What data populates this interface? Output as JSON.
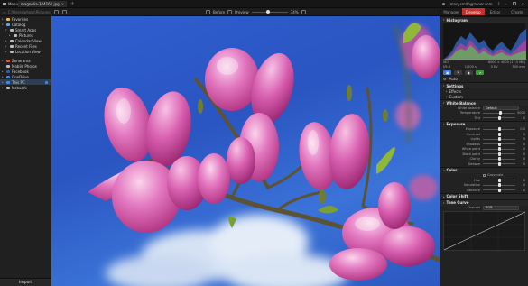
{
  "titlebar": {
    "menu_label": "Menu",
    "tab_title": "magnolia-324161.jpg",
    "user": "mary.smith@zoner.com"
  },
  "left": {
    "path": "C:\\Users\\photo\\Pictures",
    "items": [
      {
        "label": "Favorites",
        "icon": "star-icon",
        "color": "#e8c23a",
        "indent": 0,
        "twisty": "▸"
      },
      {
        "label": "Catalog",
        "icon": "catalog-icon",
        "color": "#6aa0e0",
        "indent": 0,
        "twisty": "▾"
      },
      {
        "label": "Smart Apps",
        "icon": "folder-icon",
        "color": "#bbbbbb",
        "indent": 1,
        "twisty": "▾"
      },
      {
        "label": "Pictures",
        "icon": "folder-icon",
        "color": "#bbbbbb",
        "indent": 2,
        "twisty": "▸"
      },
      {
        "label": "Calendar View",
        "icon": "calendar-icon",
        "color": "#bbbbbb",
        "indent": 1,
        "twisty": "▸"
      },
      {
        "label": "Recent Files",
        "icon": "clock-icon",
        "color": "#bbbbbb",
        "indent": 1,
        "twisty": "▸"
      },
      {
        "label": "Location View",
        "icon": "pin-icon",
        "color": "#bbbbbb",
        "indent": 1,
        "twisty": "▸"
      },
      {
        "label": "Zonerama",
        "icon": "cloud-icon",
        "color": "#e05a2a",
        "indent": 0,
        "twisty": "▸",
        "gap": true
      },
      {
        "label": "Mobile Photos",
        "icon": "phone-icon",
        "color": "#bbbbbb",
        "indent": 0,
        "twisty": ""
      },
      {
        "label": "Facebook",
        "icon": "facebook-icon",
        "color": "#3b5998",
        "indent": 0,
        "twisty": "▸"
      },
      {
        "label": "OneDrive",
        "icon": "onedrive-icon",
        "color": "#3a8dde",
        "indent": 0,
        "twisty": "▸"
      },
      {
        "label": "This PC",
        "icon": "computer-icon",
        "color": "#3a8dde",
        "indent": 0,
        "twisty": "▸",
        "active": true
      },
      {
        "label": "Network",
        "icon": "network-icon",
        "color": "#bbbbbb",
        "indent": 0,
        "twisty": "▸"
      }
    ],
    "import_label": "Import"
  },
  "toolbar": {
    "before_label": "Before",
    "preview_label": "Preview",
    "zoom": "34%",
    "zoom_fraction": 0.45
  },
  "right": {
    "modes": [
      "Manager",
      "Develop",
      "Editor",
      "Create"
    ],
    "active_mode": "Develop",
    "histogram_title": "Histogram",
    "exif": {
      "iso": "ISO",
      "dims": "6000 × 4000 (17,5 MB)",
      "aperture": "f/5.6",
      "shutter": "1/500 s",
      "focal": "300 mm",
      "ev": "0 EV"
    },
    "auto_label": "Auto",
    "settings_title": "Settings",
    "effects_label": "Effects",
    "custom_label": "Custom",
    "wb_title": "White Balance",
    "wb_preset_label": "White balance",
    "wb_preset": "Default",
    "wb_controls": [
      {
        "label": "Temperature",
        "value": "5000",
        "pos": 0.55
      },
      {
        "label": "Tint",
        "value": "0",
        "pos": 0.5
      }
    ],
    "exposure_title": "Exposure",
    "exposure_controls": [
      {
        "label": "Exposure",
        "value": "0.0",
        "pos": 0.5
      },
      {
        "label": "Contrast",
        "value": "0",
        "pos": 0.5
      },
      {
        "label": "Lights",
        "value": "0",
        "pos": 0.5
      },
      {
        "label": "Shadows",
        "value": "0",
        "pos": 0.5
      },
      {
        "label": "White point",
        "value": "0",
        "pos": 0.5
      },
      {
        "label": "Black point",
        "value": "0",
        "pos": 0.5
      },
      {
        "label": "Clarity",
        "value": "0",
        "pos": 0.5
      },
      {
        "label": "Dehaze",
        "value": "0",
        "pos": 0.5
      }
    ],
    "color_title": "Color",
    "grayscale_label": "Grayscale",
    "color_controls": [
      {
        "label": "Hue",
        "value": "0",
        "pos": 0.5
      },
      {
        "label": "Saturation",
        "value": "0",
        "pos": 0.5
      },
      {
        "label": "Vibrance",
        "value": "0",
        "pos": 0.5
      }
    ],
    "color_shift_title": "Color Shift",
    "tone_curve_title": "Tone Curve",
    "channel_label": "Channel",
    "channel_value": "RGB"
  }
}
